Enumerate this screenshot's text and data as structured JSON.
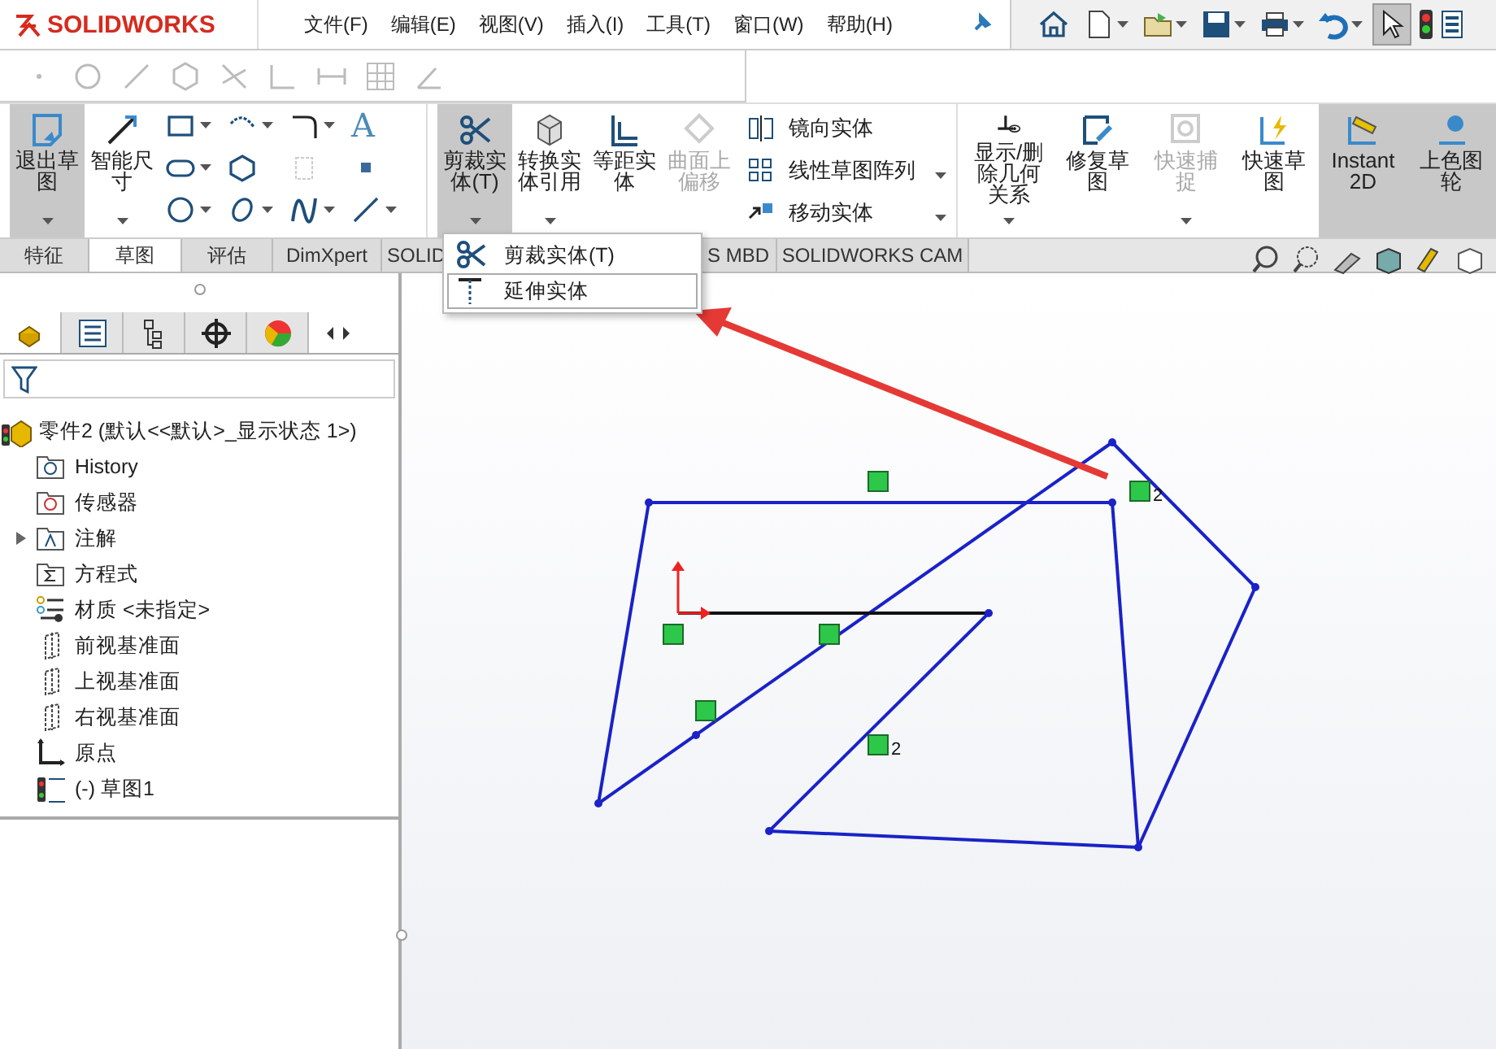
{
  "title_bar": {
    "logo": "SOLIDWORKS",
    "menus": [
      "文件(F)",
      "编辑(E)",
      "视图(V)",
      "插入(I)",
      "工具(T)",
      "窗口(W)",
      "帮助(H)"
    ],
    "select_pressed": true
  },
  "ribbon": {
    "buttons": [
      {
        "label": "退出草图",
        "kind": "large",
        "selected": true,
        "disabled": false,
        "caret": true
      },
      {
        "label": "智能尺寸",
        "kind": "large",
        "selected": false,
        "disabled": false,
        "caret": true
      },
      {
        "kind": "tools",
        "glyph": "A"
      },
      {
        "label": "剪裁实体(T)",
        "kind": "large",
        "selected": true,
        "disabled": false,
        "caret": true
      },
      {
        "label": "转换实体引用",
        "kind": "large",
        "selected": false,
        "disabled": false,
        "caret": true
      },
      {
        "label": "等距实体",
        "kind": "large",
        "selected": false,
        "disabled": false,
        "caret": false
      },
      {
        "label": "曲面上偏移",
        "kind": "large",
        "selected": false,
        "disabled": true,
        "caret": false
      },
      {
        "kind": "list",
        "items": [
          {
            "label": "镜向实体",
            "caret": false
          },
          {
            "label": "线性草图阵列",
            "caret": true
          },
          {
            "label": "移动实体",
            "caret": true
          }
        ]
      },
      {
        "label": "显示/删除几何关系",
        "kind": "large",
        "selected": false,
        "disabled": false,
        "caret": true
      },
      {
        "label": "修复草图",
        "kind": "large",
        "selected": false,
        "disabled": false,
        "caret": false
      },
      {
        "label": "快速捕捉",
        "kind": "large",
        "selected": false,
        "disabled": true,
        "caret": true
      },
      {
        "label": "快速草图",
        "kind": "large",
        "selected": false,
        "disabled": false,
        "caret": false
      },
      {
        "label": "Instant2D",
        "kind": "large",
        "selected": true,
        "disabled": false,
        "caret": false
      },
      {
        "label": "上色图轮",
        "kind": "large",
        "selected": true,
        "disabled": false,
        "caret": false
      }
    ]
  },
  "tabs": [
    {
      "label": "特征",
      "selected": false
    },
    {
      "label": "草图",
      "selected": true
    },
    {
      "label": "评估",
      "selected": false
    },
    {
      "label": "DimXpert",
      "selected": false
    },
    {
      "label": "SOLID",
      "selected": false
    },
    {
      "label": "S MBD",
      "selected": false
    },
    {
      "label": "SOLIDWORKS CAM",
      "selected": false
    }
  ],
  "dropdown": {
    "items": [
      {
        "label": "剪裁实体(T)",
        "selected": false
      },
      {
        "label": "延伸实体",
        "selected": true
      }
    ]
  },
  "panel_tabs": [
    {
      "selected": true
    },
    {
      "selected": false
    },
    {
      "selected": false
    },
    {
      "selected": false
    },
    {
      "selected": false
    }
  ],
  "feature_tree": {
    "root": "零件2  (默认<<默认>_显示状态 1>)",
    "items": [
      {
        "label": "History",
        "expandable": false
      },
      {
        "label": "传感器",
        "expandable": false
      },
      {
        "label": "注解",
        "expandable": true
      },
      {
        "label": "方程式",
        "expandable": false
      },
      {
        "label": "材质 <未指定>",
        "expandable": false
      },
      {
        "label": "前视基准面",
        "expandable": false
      },
      {
        "label": "上视基准面",
        "expandable": false
      },
      {
        "label": "右视基准面",
        "expandable": false
      },
      {
        "label": "原点",
        "expandable": false
      },
      {
        "label": "(-) 草图1",
        "expandable": false
      }
    ]
  },
  "sketch": {
    "relation_labels": [
      "2",
      "2"
    ]
  }
}
